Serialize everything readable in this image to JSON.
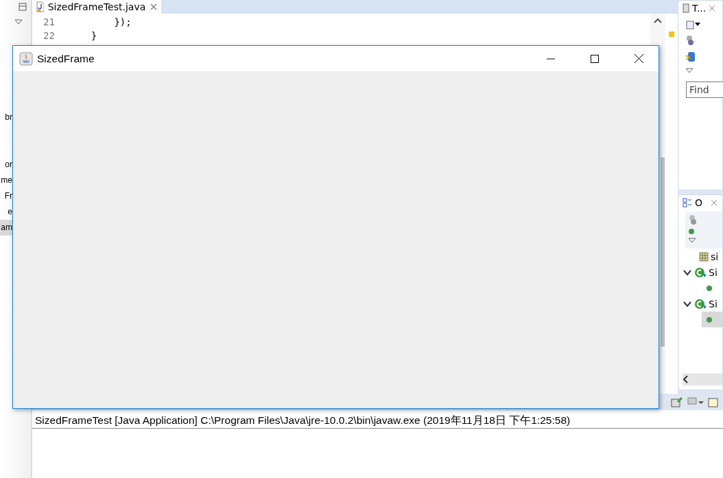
{
  "package_explorer": {
    "items": [
      {
        "label": "br",
        "selected": false
      },
      {
        "label": "or",
        "selected": false
      },
      {
        "label": "me",
        "selected": false
      },
      {
        "label": "Fr",
        "selected": false
      },
      {
        "label": "e",
        "selected": false
      },
      {
        "label": "am",
        "selected": true
      }
    ]
  },
  "editor": {
    "tab": {
      "label": "SizedFrameTest.java",
      "selected": true
    },
    "lines": [
      {
        "number": "21",
        "code": "        });"
      },
      {
        "number": "22",
        "code": "    }"
      }
    ]
  },
  "task_list": {
    "title": "T...",
    "find": {
      "placeholder": "Find"
    }
  },
  "outline": {
    "title": "O",
    "items": [
      {
        "kind": "import",
        "label": "si"
      },
      {
        "kind": "class",
        "label": "Si",
        "expanded": true
      },
      {
        "kind": "field",
        "selected": false
      },
      {
        "kind": "class",
        "label": "Si",
        "expanded": true
      },
      {
        "kind": "field",
        "selected": true
      }
    ]
  },
  "console": {
    "launch": "SizedFrameTest [Java Application] C:\\Program Files\\Java\\jre-10.0.2\\bin\\javaw.exe (2019年11月18日 下午1:25:58)"
  },
  "frame": {
    "title": "SizedFrame"
  }
}
